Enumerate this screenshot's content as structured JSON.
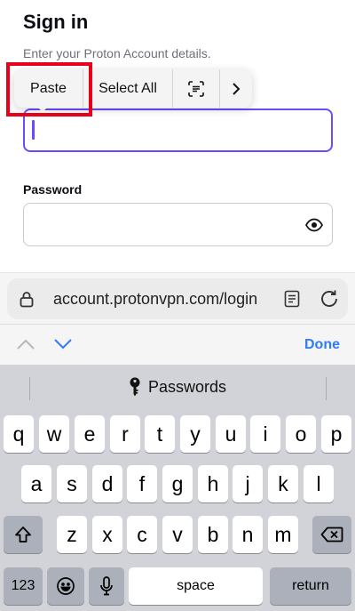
{
  "header": {
    "title": "Sign in",
    "subtitle": "Enter your Proton Account details."
  },
  "edit_menu": {
    "paste": "Paste",
    "select_all": "Select All",
    "scan_icon": "scan-text-icon",
    "more_icon": "chevron-right-icon"
  },
  "form": {
    "username_value": "",
    "password_label": "Password",
    "password_value": "",
    "show_password_icon": "eye-icon"
  },
  "browser": {
    "url": "account.protonvpn.com/login",
    "lock_icon": "lock-icon",
    "reader_icon": "reader-icon",
    "reload_icon": "reload-icon"
  },
  "accessory": {
    "done": "Done",
    "prev_icon": "chevron-up-icon",
    "next_icon": "chevron-down-icon"
  },
  "keyboard": {
    "suggestion": "Passwords",
    "row1": [
      "q",
      "w",
      "e",
      "r",
      "t",
      "y",
      "u",
      "i",
      "o",
      "p"
    ],
    "row2": [
      "a",
      "s",
      "d",
      "f",
      "g",
      "h",
      "j",
      "k",
      "l"
    ],
    "row3": [
      "z",
      "x",
      "c",
      "v",
      "b",
      "n",
      "m"
    ],
    "numbers": "123",
    "space": "space",
    "return": "return",
    "shift_icon": "shift-icon",
    "delete_icon": "delete-icon",
    "emoji_icon": "emoji-icon",
    "mic_icon": "microphone-icon"
  },
  "colors": {
    "accent": "#6d4aff",
    "link": "#2f7cf6",
    "highlight": "#e8001a"
  }
}
